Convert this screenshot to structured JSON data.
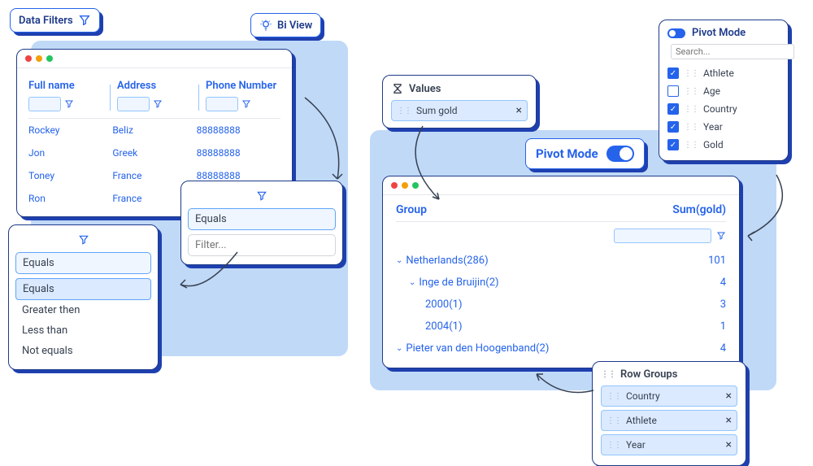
{
  "tags": {
    "data_filters": "Data Filters",
    "bi_view": "Bi View"
  },
  "grid": {
    "columns": [
      "Full name",
      "Address",
      "Phone Number"
    ],
    "rows": [
      {
        "name": "Rockey",
        "address": "Beliz",
        "phone": "88888888"
      },
      {
        "name": "Jon",
        "address": "Greek",
        "phone": "88888888"
      },
      {
        "name": "Toney",
        "address": "France",
        "phone": "88888888"
      },
      {
        "name": "Ron",
        "address": "France",
        "phone": ""
      }
    ]
  },
  "filter_popup": {
    "selected": "Equals",
    "placeholder": "Filter..."
  },
  "filter_dropdown": {
    "selected": "Equals",
    "options": [
      "Equals",
      "Greater then",
      "Less than",
      "Not equals"
    ]
  },
  "values_box": {
    "title": "Values",
    "chip": "Sum gold"
  },
  "pivot_toggle": {
    "label": "Pivot Mode"
  },
  "pivot_window": {
    "col_group": "Group",
    "col_sum": "Sum(gold)",
    "rows": [
      {
        "label": "Netherlands(286)",
        "value": "101",
        "indent": 0,
        "expand": true
      },
      {
        "label": "Inge de Bruijin(2)",
        "value": "4",
        "indent": 1,
        "expand": true
      },
      {
        "label": "2000(1)",
        "value": "3",
        "indent": 2,
        "expand": false
      },
      {
        "label": "2004(1)",
        "value": "1",
        "indent": 2,
        "expand": false
      },
      {
        "label": "Pieter van den Hoogenband(2)",
        "value": "4",
        "indent": 0,
        "expand": true
      }
    ]
  },
  "side_panel": {
    "title": "Pivot Mode",
    "search_placeholder": "Search...",
    "fields": [
      {
        "label": "Athlete",
        "checked": true
      },
      {
        "label": "Age",
        "checked": false
      },
      {
        "label": "Country",
        "checked": true
      },
      {
        "label": "Year",
        "checked": true
      },
      {
        "label": "Gold",
        "checked": true
      }
    ]
  },
  "row_groups": {
    "title": "Row Groups",
    "chips": [
      "Country",
      "Athlete",
      "Year"
    ]
  }
}
